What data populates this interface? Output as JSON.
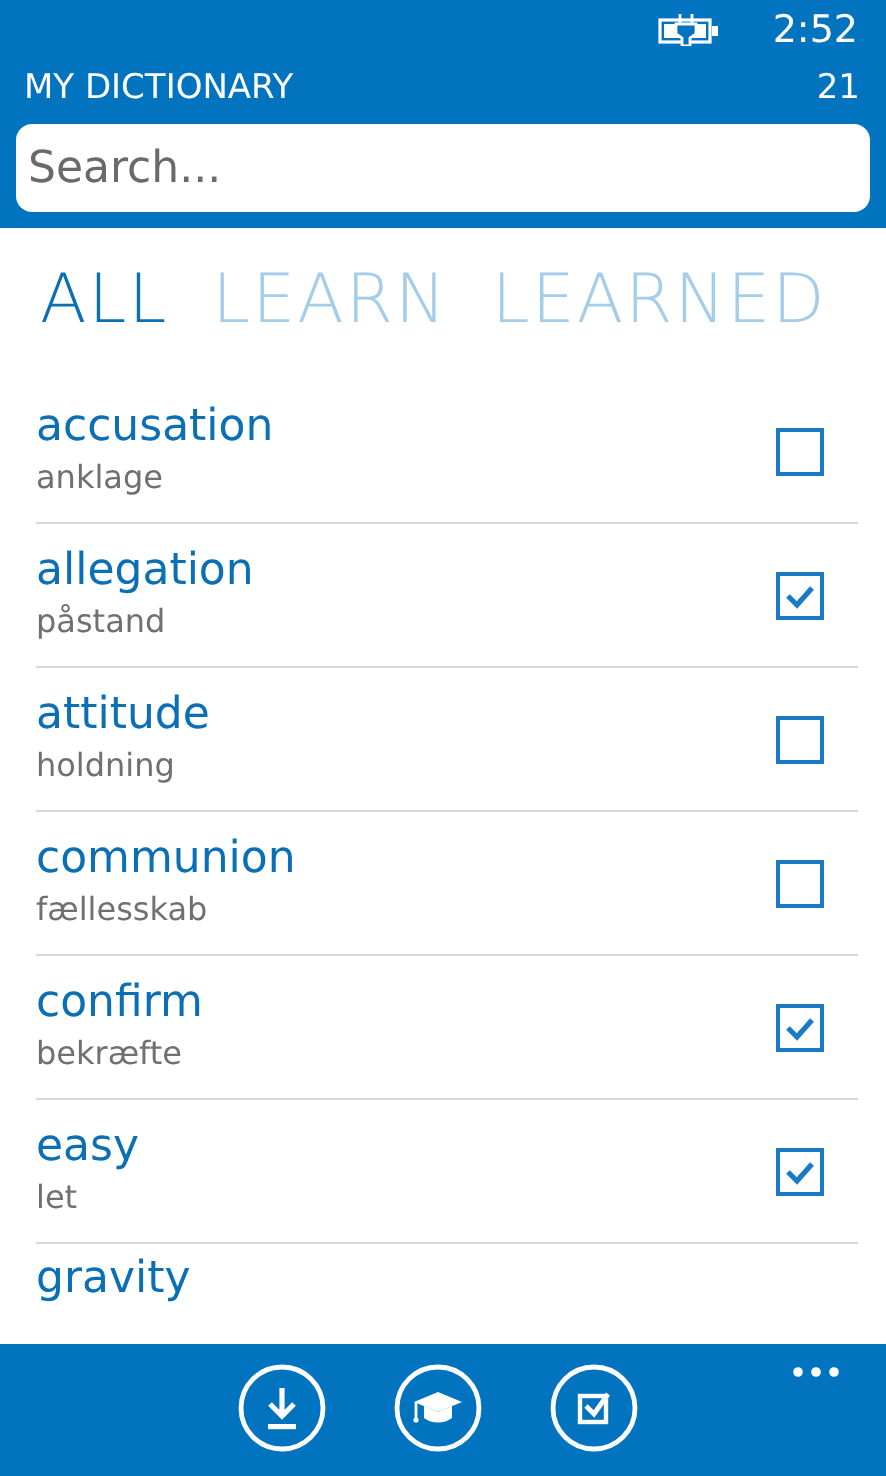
{
  "status_bar": {
    "time": "2:52"
  },
  "header": {
    "title": "MY DICTIONARY",
    "count": "21"
  },
  "search": {
    "placeholder": "Search..."
  },
  "pivots": [
    {
      "label": "ALL",
      "selected": true
    },
    {
      "label": "LEARN",
      "selected": false
    },
    {
      "label": "LEARNED",
      "selected": false
    }
  ],
  "words": [
    {
      "word": "accusation",
      "translation": "anklage",
      "checked": false
    },
    {
      "word": "allegation",
      "translation": "påstand",
      "checked": true
    },
    {
      "word": "attitude",
      "translation": "holdning",
      "checked": false
    },
    {
      "word": "communion",
      "translation": "fællesskab",
      "checked": false
    },
    {
      "word": "confirm",
      "translation": "bekræfte",
      "checked": true
    },
    {
      "word": "easy",
      "translation": "let",
      "checked": true
    },
    {
      "word": "gravity"
    }
  ],
  "app_bar": {
    "buttons": [
      {
        "kind": "download"
      },
      {
        "kind": "learn"
      },
      {
        "kind": "learned"
      }
    ]
  }
}
